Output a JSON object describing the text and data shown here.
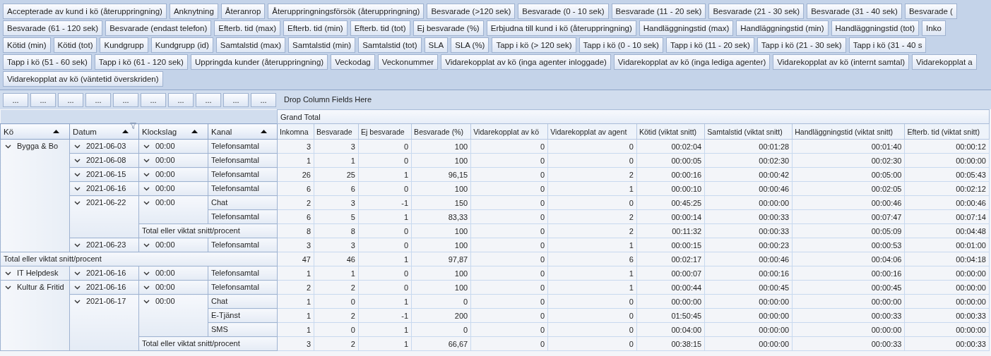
{
  "field_list": [
    [
      "Accepterade av kund i kö (återuppringning)",
      "Anknytning",
      "Återanrop",
      "Återuppringningsförsök (återuppringning)",
      "Besvarade (>120 sek)",
      "Besvarade (0 - 10 sek)",
      "Besvarade (11 - 20 sek)",
      "Besvarade (21 - 30 sek)",
      "Besvarade (31 - 40 sek)",
      "Besvarade ("
    ],
    [
      "Besvarade (61 - 120 sek)",
      "Besvarade (endast telefon)",
      "Efterb. tid (max)",
      "Efterb. tid (min)",
      "Efterb. tid (tot)",
      "Ej besvarade (%)",
      "Erbjudna till kund i kö (återuppringning)",
      "Handläggningstid (max)",
      "Handläggningstid (min)",
      "Handläggningstid (tot)",
      "Inko"
    ],
    [
      "Kötid (min)",
      "Kötid (tot)",
      "Kundgrupp",
      "Kundgrupp (id)",
      "Samtalstid (max)",
      "Samtalstid (min)",
      "Samtalstid (tot)",
      "SLA",
      "SLA (%)",
      "Tapp i kö (> 120 sek)",
      "Tapp i kö (0 - 10 sek)",
      "Tapp i kö (11 - 20 sek)",
      "Tapp i kö (21 - 30 sek)",
      "Tapp i kö (31 - 40 s"
    ],
    [
      "Tapp i kö (51 - 60 sek)",
      "Tapp i kö (61 - 120 sek)",
      "Uppringda kunder (återuppringning)",
      "Veckodag",
      "Veckonummer",
      "Vidarekopplat av kö (inga agenter inloggade)",
      "Vidarekopplat av kö (inga lediga agenter)",
      "Vidarekopplat av kö (internt samtal)",
      "Vidarekopplat a"
    ],
    [
      "Vidarekopplat av kö (väntetid överskriden)"
    ]
  ],
  "filter_buttons": [
    "...",
    "...",
    "...",
    "...",
    "...",
    "...",
    "...",
    "...",
    "...",
    "..."
  ],
  "column_drop_hint": "Drop Column Fields Here",
  "grand_total": "Grand Total",
  "row_fields": [
    {
      "label": "Kö",
      "sorted": true,
      "filtered": false
    },
    {
      "label": "Datum",
      "sorted": true,
      "filtered": true
    },
    {
      "label": "Klockslag",
      "sorted": true,
      "filtered": false
    },
    {
      "label": "Kanal",
      "sorted": true,
      "filtered": false
    }
  ],
  "columns": [
    "Inkomna",
    "Besvarade",
    "Ej besvarade",
    "Besvarade (%)",
    "Vidarekopplat av kö",
    "Vidarekopplat av agent",
    "Kötid (viktat snitt)",
    "Samtalstid (viktat snitt)",
    "Handläggningstid (viktat snitt)",
    "Efterb. tid (viktat snitt)"
  ],
  "rows": [
    {
      "name": "Bygga & Bo",
      "expanded": true,
      "children": [
        {
          "name": "2021-06-03",
          "expanded": true,
          "children": [
            {
              "name": "00:00",
              "expanded": true,
              "children": [
                {
                  "name": "Telefonsamtal",
                  "values": [
                    "3",
                    "3",
                    "0",
                    "100",
                    "0",
                    "0",
                    "00:02:04",
                    "00:01:28",
                    "00:01:40",
                    "00:00:12"
                  ]
                }
              ]
            }
          ]
        },
        {
          "name": "2021-06-08",
          "expanded": true,
          "children": [
            {
              "name": "00:00",
              "expanded": true,
              "children": [
                {
                  "name": "Telefonsamtal",
                  "values": [
                    "1",
                    "1",
                    "0",
                    "100",
                    "0",
                    "0",
                    "00:00:05",
                    "00:02:30",
                    "00:02:30",
                    "00:00:00"
                  ]
                }
              ]
            }
          ]
        },
        {
          "name": "2021-06-15",
          "expanded": true,
          "children": [
            {
              "name": "00:00",
              "expanded": true,
              "children": [
                {
                  "name": "Telefonsamtal",
                  "values": [
                    "26",
                    "25",
                    "1",
                    "96,15",
                    "0",
                    "2",
                    "00:00:16",
                    "00:00:42",
                    "00:05:00",
                    "00:05:43"
                  ]
                }
              ]
            }
          ]
        },
        {
          "name": "2021-06-16",
          "expanded": true,
          "children": [
            {
              "name": "00:00",
              "expanded": true,
              "children": [
                {
                  "name": "Telefonsamtal",
                  "values": [
                    "6",
                    "6",
                    "0",
                    "100",
                    "0",
                    "1",
                    "00:00:10",
                    "00:00:46",
                    "00:02:05",
                    "00:02:12"
                  ]
                }
              ]
            }
          ]
        },
        {
          "name": "2021-06-22",
          "expanded": true,
          "children": [
            {
              "name": "00:00",
              "expanded": true,
              "children": [
                {
                  "name": "Chat",
                  "values": [
                    "2",
                    "3",
                    "-1",
                    "150",
                    "0",
                    "0",
                    "00:45:25",
                    "00:00:00",
                    "00:00:46",
                    "00:00:46"
                  ]
                },
                {
                  "name": "Telefonsamtal",
                  "values": [
                    "6",
                    "5",
                    "1",
                    "83,33",
                    "0",
                    "2",
                    "00:00:14",
                    "00:00:33",
                    "00:07:47",
                    "00:07:14"
                  ]
                }
              ],
              "total": {
                "label": "Total eller viktat snitt/procent",
                "values": [
                  "8",
                  "8",
                  "0",
                  "100",
                  "0",
                  "2",
                  "00:11:32",
                  "00:00:33",
                  "00:05:09",
                  "00:04:48"
                ]
              }
            }
          ]
        },
        {
          "name": "2021-06-23",
          "expanded": true,
          "children": [
            {
              "name": "00:00",
              "expanded": true,
              "children": [
                {
                  "name": "Telefonsamtal",
                  "values": [
                    "3",
                    "3",
                    "0",
                    "100",
                    "0",
                    "1",
                    "00:00:15",
                    "00:00:23",
                    "00:00:53",
                    "00:01:00"
                  ]
                }
              ]
            }
          ]
        }
      ],
      "total": {
        "label": "Total eller viktat snitt/procent",
        "values": [
          "47",
          "46",
          "1",
          "97,87",
          "0",
          "6",
          "00:02:17",
          "00:00:46",
          "00:04:06",
          "00:04:18"
        ]
      }
    },
    {
      "name": "IT Helpdesk",
      "expanded": true,
      "children": [
        {
          "name": "2021-06-16",
          "expanded": true,
          "children": [
            {
              "name": "00:00",
              "expanded": true,
              "children": [
                {
                  "name": "Telefonsamtal",
                  "values": [
                    "1",
                    "1",
                    "0",
                    "100",
                    "0",
                    "1",
                    "00:00:07",
                    "00:00:16",
                    "00:00:16",
                    "00:00:00"
                  ]
                }
              ]
            }
          ]
        }
      ]
    },
    {
      "name": "Kultur & Fritid",
      "expanded": true,
      "children": [
        {
          "name": "2021-06-16",
          "expanded": true,
          "children": [
            {
              "name": "00:00",
              "expanded": true,
              "children": [
                {
                  "name": "Telefonsamtal",
                  "values": [
                    "2",
                    "2",
                    "0",
                    "100",
                    "0",
                    "1",
                    "00:00:44",
                    "00:00:45",
                    "00:00:45",
                    "00:00:00"
                  ]
                }
              ]
            }
          ]
        },
        {
          "name": "2021-06-17",
          "expanded": true,
          "children": [
            {
              "name": "00:00",
              "expanded": true,
              "children": [
                {
                  "name": "Chat",
                  "values": [
                    "1",
                    "0",
                    "1",
                    "0",
                    "0",
                    "0",
                    "00:00:00",
                    "00:00:00",
                    "00:00:00",
                    "00:00:00"
                  ]
                },
                {
                  "name": "E-Tjänst",
                  "values": [
                    "1",
                    "2",
                    "-1",
                    "200",
                    "0",
                    "0",
                    "01:50:45",
                    "00:00:00",
                    "00:00:33",
                    "00:00:33"
                  ]
                },
                {
                  "name": "SMS",
                  "values": [
                    "1",
                    "0",
                    "1",
                    "0",
                    "0",
                    "0",
                    "00:04:00",
                    "00:00:00",
                    "00:00:00",
                    "00:00:00"
                  ]
                }
              ],
              "total": {
                "label": "Total eller viktat snitt/procent",
                "values": [
                  "3",
                  "2",
                  "1",
                  "66,67",
                  "0",
                  "0",
                  "00:38:15",
                  "00:00:00",
                  "00:00:33",
                  "00:00:33"
                ]
              }
            }
          ]
        }
      ]
    }
  ]
}
